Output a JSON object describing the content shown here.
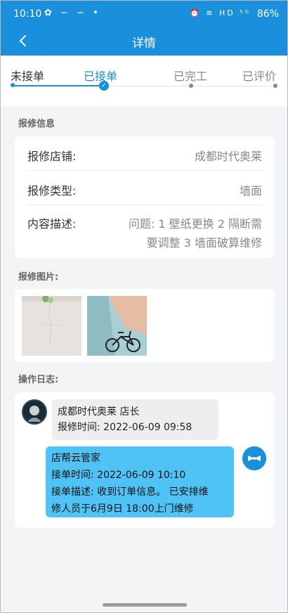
{
  "status_bar": {
    "time": "10:10",
    "left_icons": "✿ ∽ ∽ •",
    "right_icons": "⏰ ≋ HD ⁵ᴳ",
    "battery": "86%"
  },
  "header": {
    "title": "详情"
  },
  "steps": [
    {
      "label": "未接单",
      "state": "done"
    },
    {
      "label": "已接单",
      "state": "current"
    },
    {
      "label": "已完工",
      "state": "todo"
    },
    {
      "label": "已评价",
      "state": "todo"
    }
  ],
  "repair_info": {
    "section_title": "报修信息",
    "shop_label": "报修店铺:",
    "shop_value": "成都时代奥莱",
    "type_label": "报修类型:",
    "type_value": "墙面",
    "desc_label": "内容描述:",
    "desc_line1": "问题: 1 壁纸更换 2 隔断需",
    "desc_line2": "要调整 3 墙面破算维修"
  },
  "repair_photos": {
    "section_title": "报修图片:"
  },
  "operation_log": {
    "section_title": "操作日志:",
    "entry1_name": "成都时代奥莱 店长",
    "entry1_time": "报修时间: 2022-06-09 09:58",
    "entry2_name": "店帮云管家",
    "entry2_time": "接单时间: 2022-06-09 10:10",
    "entry2_desc1": "接单描述: 收到订单信息。 已安排维",
    "entry2_desc2": "修人员于6月9日 18:00上门维修"
  },
  "colors": {
    "primary": "#1a8fdb",
    "bubble": "#4fc3f5"
  }
}
